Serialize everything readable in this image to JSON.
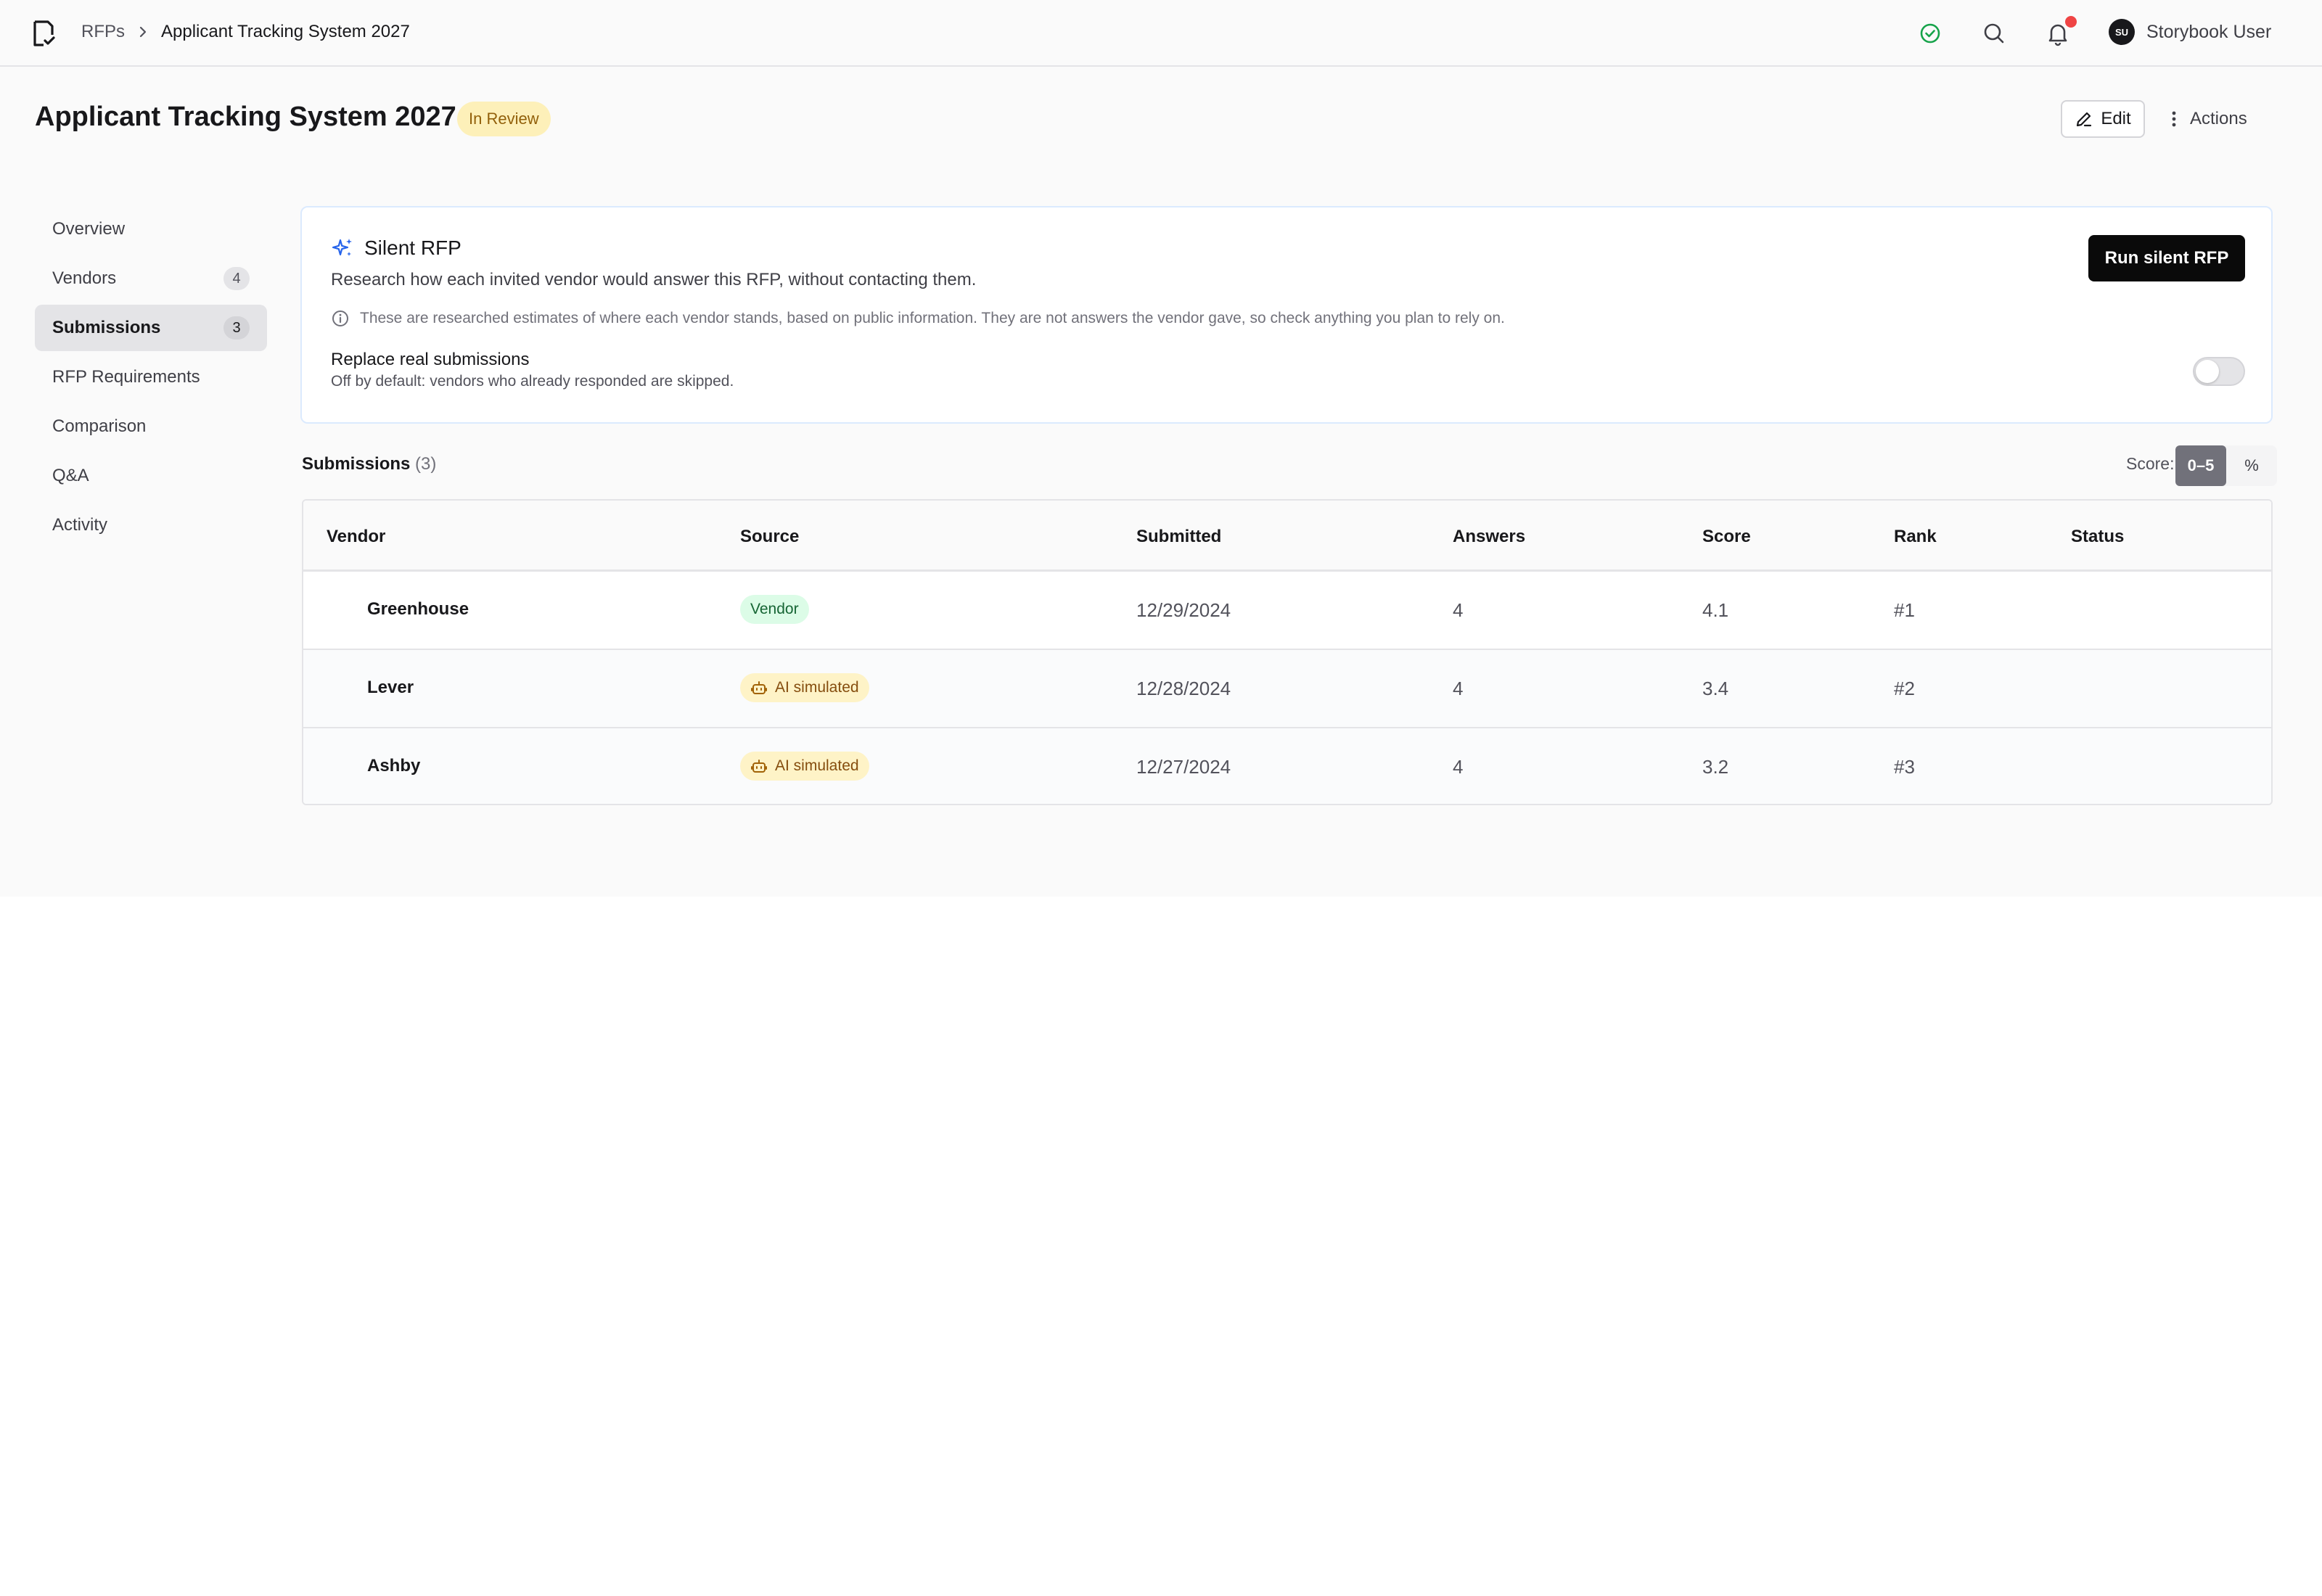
{
  "breadcrumb": {
    "root": "RFPs",
    "current": "Applicant Tracking System 2027"
  },
  "user": {
    "initials": "SU",
    "name": "Storybook User"
  },
  "header": {
    "title": "Applicant Tracking System 2027",
    "status": "In Review",
    "edit_label": "Edit",
    "actions_label": "Actions"
  },
  "sidebar": {
    "items": [
      {
        "label": "Overview",
        "badge": ""
      },
      {
        "label": "Vendors",
        "badge": "4"
      },
      {
        "label": "Submissions",
        "badge": "3",
        "active": true
      },
      {
        "label": "RFP Requirements",
        "badge": ""
      },
      {
        "label": "Comparison",
        "badge": ""
      },
      {
        "label": "Q&A",
        "badge": ""
      },
      {
        "label": "Activity",
        "badge": ""
      }
    ]
  },
  "silent_rfp": {
    "title": "Silent RFP",
    "description": "Research how each invited vendor would answer this RFP, without contacting them.",
    "note": "These are researched estimates of where each vendor stands, based on public information. They are not answers the vendor gave, so check anything you plan to rely on.",
    "run_label": "Run silent RFP",
    "option_label": "Replace real submissions",
    "option_help": "Off by default: vendors who already responded are skipped.",
    "option_enabled": false
  },
  "submissions": {
    "title": "Submissions",
    "count": "(3)",
    "score_label": "Score:",
    "score_modes": [
      "0–5",
      "%"
    ],
    "score_mode_selected": "0–5",
    "columns": [
      "Vendor",
      "Source",
      "Submitted",
      "Answers",
      "Score",
      "Rank",
      "Status"
    ],
    "rows": [
      {
        "vendor": "Greenhouse",
        "source": "Vendor",
        "source_type": "vendor",
        "submitted": "12/29/2024",
        "answers": "4",
        "score": "4.1",
        "rank": "#1",
        "status": ""
      },
      {
        "vendor": "Lever",
        "source": "AI simulated",
        "source_type": "ai",
        "submitted": "12/28/2024",
        "answers": "4",
        "score": "3.4",
        "rank": "#2",
        "status": ""
      },
      {
        "vendor": "Ashby",
        "source": "AI simulated",
        "source_type": "ai",
        "submitted": "12/27/2024",
        "answers": "4",
        "score": "3.2",
        "rank": "#3",
        "status": ""
      }
    ]
  },
  "colors": {
    "accent_blue": "#2563eb",
    "status_green": "#16a34a",
    "notification_red": "#ef4444",
    "review_yellow": "#fdf0b9"
  }
}
